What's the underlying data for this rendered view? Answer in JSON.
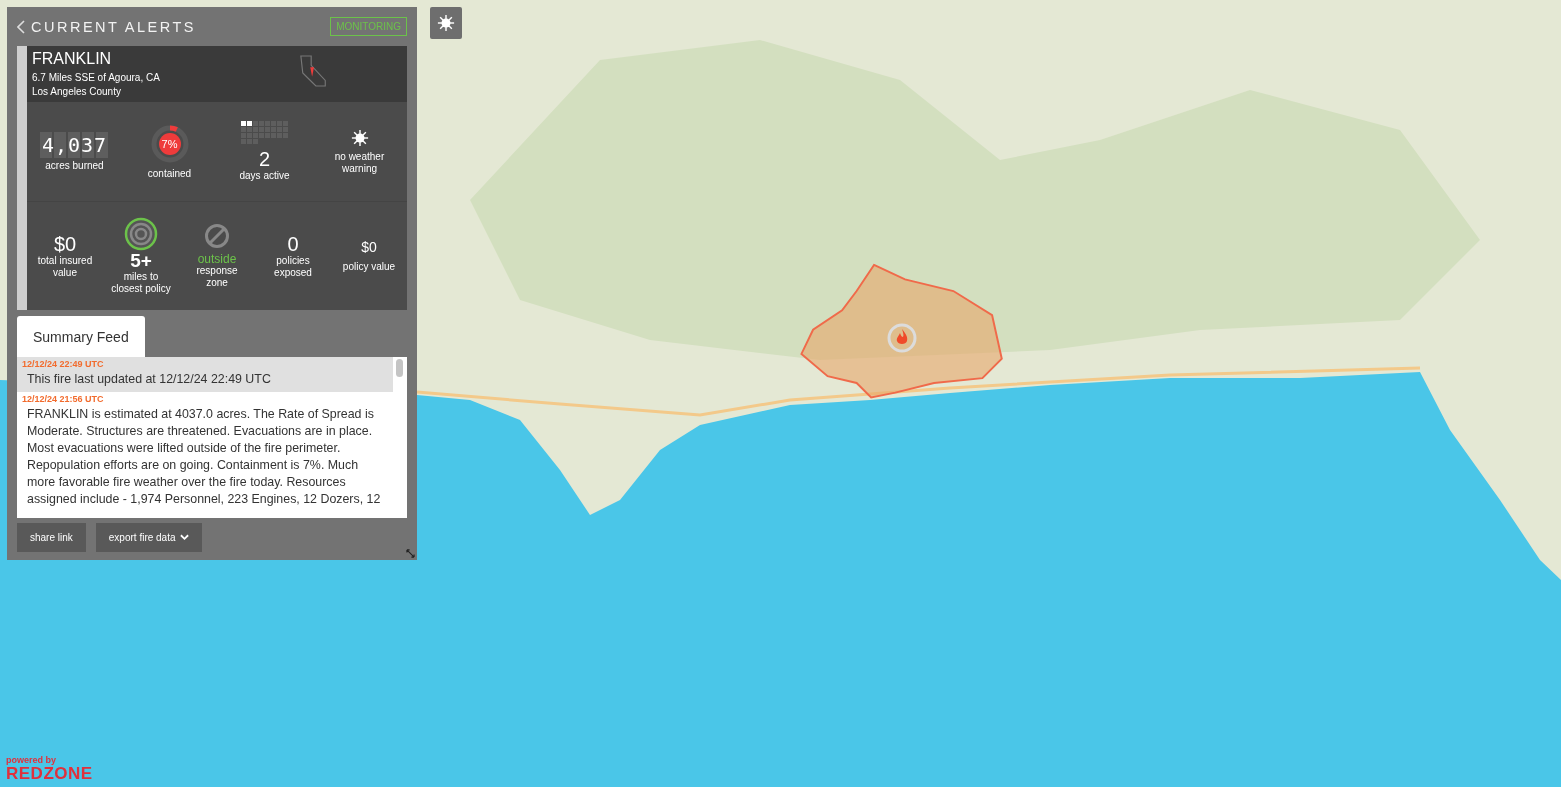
{
  "panel": {
    "title": "CURRENT ALERTS",
    "status_badge": "MONITORING",
    "fire": {
      "name": "FRANKLIN",
      "location": "6.7 Miles SSE of Agoura, CA",
      "county": "Los Angeles County"
    },
    "stats": [
      {
        "kind": "counter",
        "value": "4,037",
        "label": "acres burned"
      },
      {
        "kind": "ring",
        "value": "7%",
        "level": 0.07,
        "label": "contained"
      },
      {
        "kind": "days",
        "value": "2",
        "label": "days active"
      },
      {
        "kind": "weather",
        "label": "no weather warning"
      }
    ],
    "day_cells": [
      {
        "filled": true
      },
      {
        "filled": true
      },
      {
        "filled": false
      },
      {
        "filled": false
      },
      {
        "filled": false
      },
      {
        "filled": false
      },
      {
        "filled": false
      },
      {
        "filled": false
      },
      {
        "filled": false
      },
      {
        "filled": false
      },
      {
        "filled": false
      },
      {
        "filled": false
      },
      {
        "filled": false
      },
      {
        "filled": false
      },
      {
        "filled": false
      },
      {
        "filled": false
      },
      {
        "filled": false
      },
      {
        "filled": false
      },
      {
        "filled": false
      },
      {
        "filled": false
      },
      {
        "filled": false
      },
      {
        "filled": false
      },
      {
        "filled": false
      },
      {
        "filled": false
      },
      {
        "filled": false
      },
      {
        "filled": false
      },
      {
        "filled": false
      }
    ],
    "exposure": [
      {
        "kind": "plain",
        "value": "$0",
        "label": "total insured value"
      },
      {
        "kind": "target",
        "value": "5+",
        "label": "miles to closest policy"
      },
      {
        "kind": "zone",
        "value": "outside",
        "label": "response zone"
      },
      {
        "kind": "plain",
        "value": "0",
        "label": "policies exposed"
      },
      {
        "kind": "small",
        "value": "$0",
        "label": "policy value"
      }
    ],
    "tabs": [
      {
        "label": "Summary Feed",
        "selected": true
      }
    ],
    "feed": [
      {
        "time": "12/12/24 22:49 UTC",
        "text": "This fire last updated at 12/12/24 22:49 UTC",
        "highlighted": true
      },
      {
        "time": "12/12/24 21:56 UTC",
        "text": "FRANKLIN is estimated at 4037.0 acres. The Rate of Spread is Moderate. Structures are threatened. Evacuations are in place. Most evacuations were lifted outside of the fire perimeter. Repopulation efforts are on going. Containment is 7%. Much more favorable fire weather over the fire today. Resources assigned include - 1,974 Personnel, 223 Engines, 12 Dozers, 12",
        "highlighted": false
      }
    ],
    "buttons": [
      {
        "label": "share link",
        "dropdown": false
      },
      {
        "label": "export fire data",
        "dropdown": true
      }
    ]
  },
  "logo": {
    "tagline": "powered by",
    "name": "REDZONE"
  }
}
